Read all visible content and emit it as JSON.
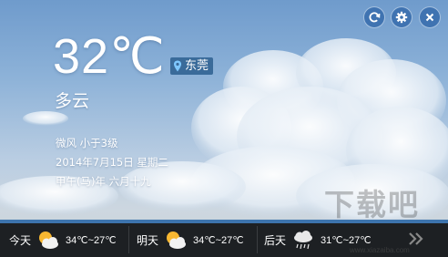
{
  "current": {
    "temperature": "32℃",
    "location": "东莞",
    "condition": "多云",
    "wind": "微风 小于3级",
    "date": "2014年7月15日 星期二",
    "lunar": "甲午(马)年 六月十九"
  },
  "toolbar": {
    "refresh_icon": "refresh-icon",
    "settings_icon": "gear-icon",
    "close_icon": "close-icon"
  },
  "forecast": [
    {
      "day": "今天",
      "icon": "partly-cloudy-icon",
      "range": "34℃~27℃"
    },
    {
      "day": "明天",
      "icon": "partly-cloudy-icon",
      "range": "34℃~27℃"
    },
    {
      "day": "后天",
      "icon": "rain-icon",
      "range": "31℃~27℃"
    }
  ],
  "next_icon": "double-chevron-right-icon",
  "watermark": {
    "text": "下载吧",
    "url": "www.xiazaiba.com"
  },
  "colors": {
    "accent": "#3f73b1",
    "bar": "#1d2023",
    "location_badge": "#3a6b9a"
  }
}
